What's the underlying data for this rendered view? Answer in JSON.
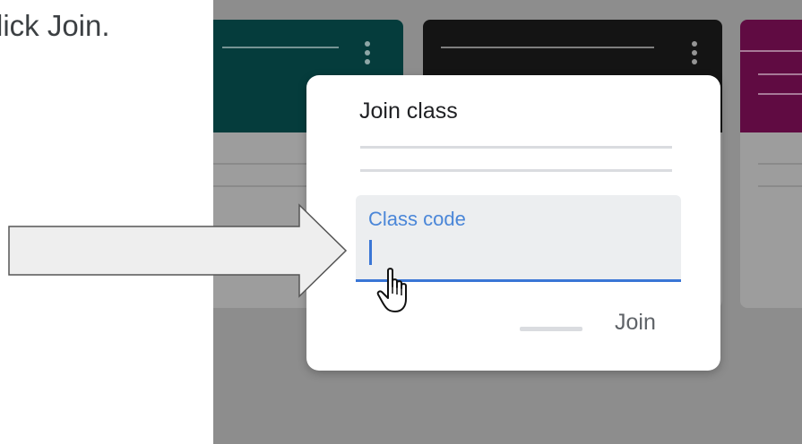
{
  "instruction": {
    "text": "lick Join."
  },
  "background_cards": [
    {
      "color": "#053c3c"
    },
    {
      "color": "#141414"
    },
    {
      "color": "#600b42"
    }
  ],
  "dialog": {
    "title": "Join class",
    "field": {
      "label": "Class code",
      "value": ""
    },
    "join_label": "Join"
  },
  "colors": {
    "accent": "#3a76d6",
    "overlay": "#8d8d8d",
    "field_bg": "#eceef0"
  },
  "icons": {
    "pointer": "hand-pointer-icon",
    "callout": "right-arrow-icon",
    "menu": "vertical-dots-icon"
  }
}
